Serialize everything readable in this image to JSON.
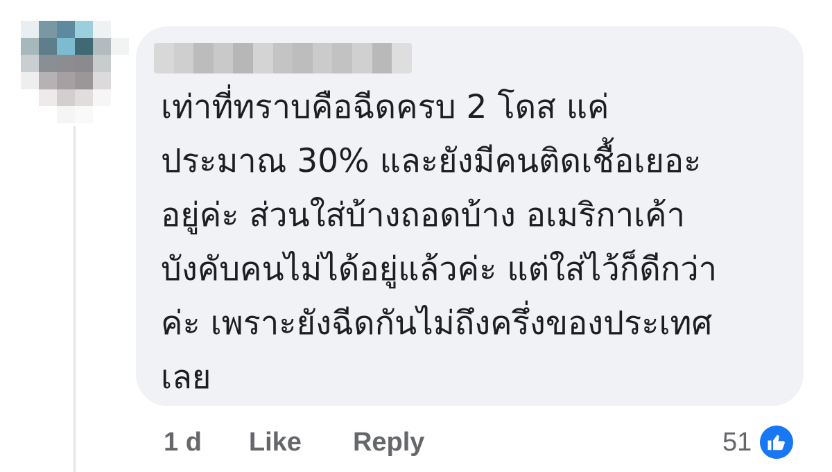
{
  "comment": {
    "text": "เท่าที่ทราบคือฉีดครบ 2 โดส แค่\nประมาณ 30% และยังมีคนติดเชื้อเยอะ\nอยู่ค่ะ ส่วนใส่บ้างถอดบ้าง อเมริกาเค้า\nบังคับคนไม่ได้อยู่แล้วค่ะ แต่ใส่ไว้ก็ดีกว่า\nค่ะ เพราะยังฉีดกันไม่ถึงครึ่งของประเทศ\nเลย",
    "timestamp": "1 d",
    "like_label": "Like",
    "reply_label": "Reply",
    "reaction_count": "51",
    "reaction_icon": "like-thumb-icon"
  },
  "colors": {
    "bubble": "#f0f2f5",
    "text": "#1c1e21",
    "secondary_text": "#65676b",
    "like_blue": "#1877f2",
    "avatar_pixels": [
      "#e9eef0",
      "#7a98a4",
      "#5d8aa0",
      "#9ccfde",
      "#eef2f2",
      "#ffffff",
      "#a7b8bc",
      "#5f7e8c",
      "#7dbbd0",
      "#3f6a73",
      "#b2bcbe",
      "#f2f4f4",
      "#c9cfd1",
      "#8a8f95",
      "#8c8c91",
      "#8c8a8f",
      "#c8cccd",
      "#ffffff",
      "#eeeeee",
      "#b6b1b3",
      "#a7a0a2",
      "#9b9698",
      "#dcdadb",
      "#ffffff",
      "#ffffff",
      "#eeeaea",
      "#d4cfcf",
      "#e1dddd",
      "#f7f6f6",
      "#ffffff",
      "#ffffff",
      "#ffffff",
      "#f5f5f5",
      "#f9f9f9",
      "#ffffff",
      "#ffffff"
    ],
    "name_pixels": [
      "#d8d8d8",
      "#cfcfcf",
      "#bcbcbc",
      "#c9c9c9",
      "#b7b7b7",
      "#d4d4d4",
      "#c4c4c4",
      "#bdbdbd",
      "#cbcbcb",
      "#c2c2c2",
      "#d0d0d0",
      "#b9b9b9",
      "#dedede"
    ]
  }
}
